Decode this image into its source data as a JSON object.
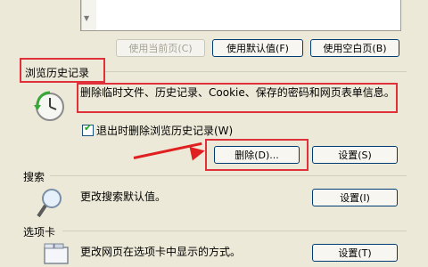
{
  "homepage": {
    "use_current_label": "使用当前页(C)",
    "use_default_label": "使用默认值(F)",
    "use_blank_label": "使用空白页(B)"
  },
  "history": {
    "title": "浏览历史记录",
    "description": "删除临时文件、历史记录、Cookie、保存的密码和网页表单信息。",
    "checkbox_label": "退出时删除浏览历史记录(W)",
    "checkbox_checked": true,
    "delete_label": "删除(D)...",
    "settings_label": "设置(S)"
  },
  "search": {
    "title": "搜索",
    "description": "更改搜索默认值。",
    "settings_label": "设置(I)"
  },
  "tabs": {
    "title": "选项卡",
    "description": "更改网页在选项卡中显示的方式。",
    "settings_label": "设置(T)"
  },
  "colors": {
    "annotation_red": "#e0303a",
    "dialog_bg": "#ece9d8"
  }
}
